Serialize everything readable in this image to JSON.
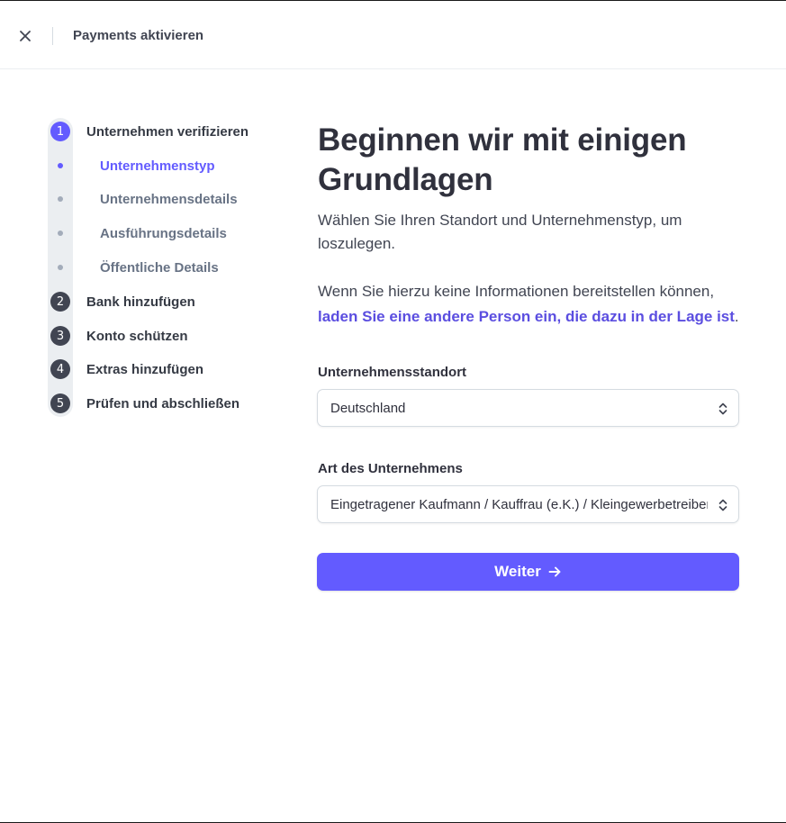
{
  "header": {
    "close_icon": "close-icon",
    "title": "Payments aktivieren"
  },
  "stepper": {
    "steps": [
      {
        "number": "1",
        "label": "Unternehmen verifizieren",
        "active": true,
        "substeps": [
          {
            "label": "Unternehmenstyp",
            "active": true
          },
          {
            "label": "Unternehmensdetails",
            "active": false
          },
          {
            "label": "Ausführungsdetails",
            "active": false
          },
          {
            "label": "Öffentliche Details",
            "active": false
          }
        ]
      },
      {
        "number": "2",
        "label": "Bank hinzufügen",
        "active": false
      },
      {
        "number": "3",
        "label": "Konto schützen",
        "active": false
      },
      {
        "number": "4",
        "label": "Extras hinzufügen",
        "active": false
      },
      {
        "number": "5",
        "label": "Prüfen und abschließen",
        "active": false
      }
    ]
  },
  "main": {
    "heading": "Beginnen wir mit einigen Grundlagen",
    "intro": "Wählen Sie Ihren Standort und Unternehmenstyp, um loszulegen.",
    "info_text": "Wenn Sie hierzu keine Informationen bereitstellen können,",
    "info_link": "laden Sie eine andere Person ein, die dazu in der Lage ist",
    "info_end": ".",
    "location_label": "Unternehmensstandort",
    "location_value": "Deutschland",
    "type_label": "Art des Unternehmens",
    "type_value": "Eingetragener Kaufmann / Kauffrau (e.K.) / Kleingewerbetreibender",
    "submit_label": "Weiter",
    "submit_icon": "arrow-right-icon"
  },
  "colors": {
    "accent": "#635bff",
    "link": "#5b4ee0",
    "text": "#30313d",
    "muted": "#687385"
  }
}
